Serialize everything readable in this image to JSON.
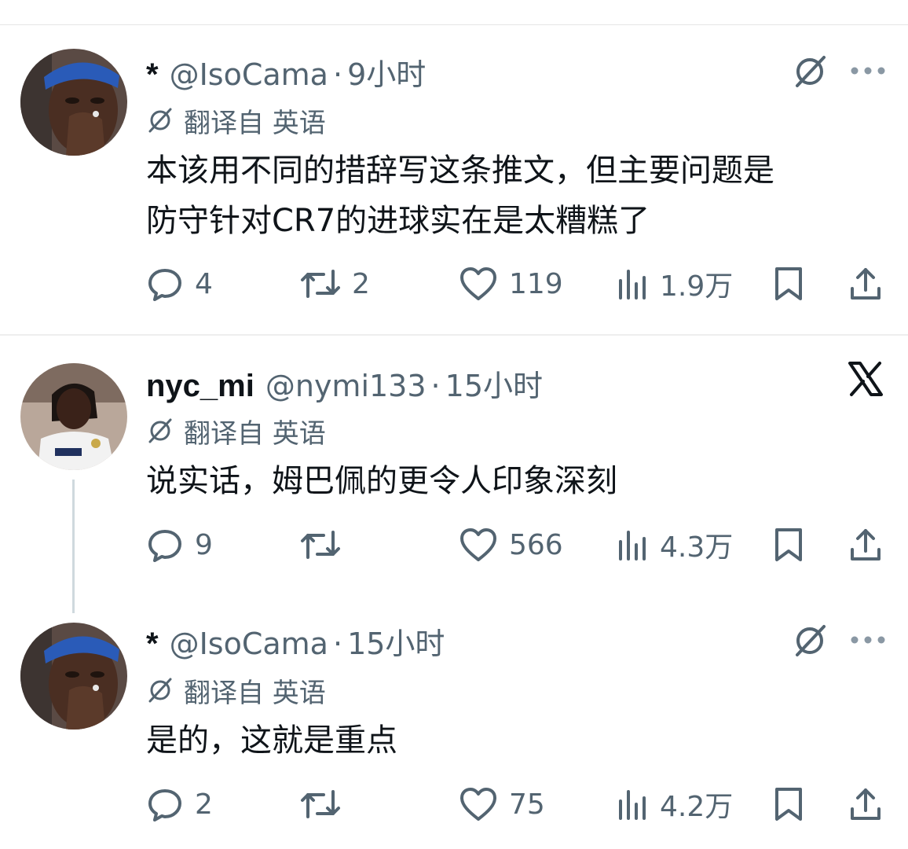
{
  "tweets": [
    {
      "name": "*",
      "handle": "@IsoCama",
      "separator": "·",
      "time": "9小时",
      "translated_label": "翻译自 英语",
      "body_lines": [
        "本该用不同的措辞写这条推文，但主要问题是",
        "防守针对CR7的进球实在是太糟糕了"
      ],
      "replies": "4",
      "retweets": "2",
      "likes": "119",
      "views": "1.9万",
      "top_right_icon": "grok-icon"
    },
    {
      "name": "nyc_mi",
      "handle": "@nymi133",
      "separator": "·",
      "time": "15小时",
      "translated_label": "翻译自 英语",
      "body_lines": [
        "说实话，姆巴佩的更令人印象深刻"
      ],
      "replies": "9",
      "retweets": "",
      "likes": "566",
      "views": "4.3万",
      "top_right_icon": "x-logo-icon"
    },
    {
      "name": "*",
      "handle": "@IsoCama",
      "separator": "·",
      "time": "15小时",
      "translated_label": "翻译自 英语",
      "body_lines": [
        "是的，这就是重点"
      ],
      "replies": "2",
      "retweets": "",
      "likes": "75",
      "views": "4.2万",
      "top_right_icon": "grok-icon"
    }
  ],
  "colors": {
    "text": "#0f1419",
    "muted": "#536471",
    "divider": "#eeeeee",
    "thread_line": "#cfd9de"
  }
}
